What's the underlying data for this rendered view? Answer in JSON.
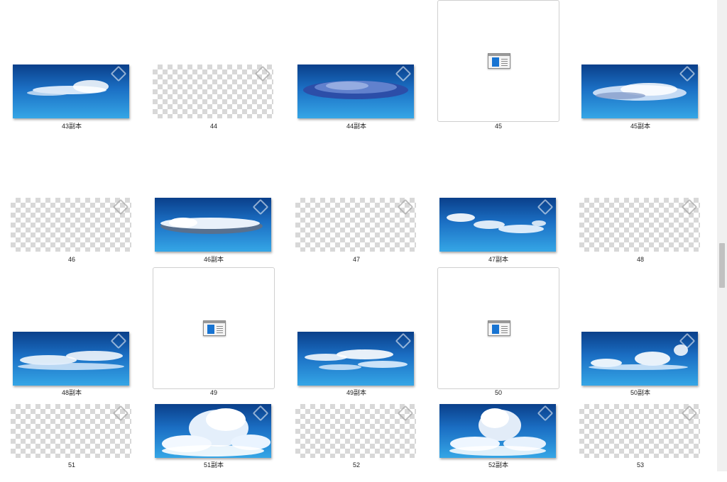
{
  "items": [
    {
      "caption": "43副本",
      "kind": "sky",
      "cloud": "wisp"
    },
    {
      "caption": "44",
      "kind": "transparent"
    },
    {
      "caption": "44副本",
      "kind": "sky",
      "cloud": "dark"
    },
    {
      "caption": "45",
      "kind": "file",
      "selected": true
    },
    {
      "caption": "45副本",
      "kind": "sky",
      "cloud": "long"
    },
    {
      "caption": "46",
      "kind": "transparent"
    },
    {
      "caption": "46副本",
      "kind": "sky",
      "cloud": "roll"
    },
    {
      "caption": "47",
      "kind": "transparent"
    },
    {
      "caption": "47副本",
      "kind": "sky",
      "cloud": "scatter"
    },
    {
      "caption": "48",
      "kind": "transparent"
    },
    {
      "caption": "48副本",
      "kind": "sky",
      "cloud": "band"
    },
    {
      "caption": "49",
      "kind": "file",
      "selected": true
    },
    {
      "caption": "49副本",
      "kind": "sky",
      "cloud": "streaks"
    },
    {
      "caption": "50",
      "kind": "file",
      "selected": true
    },
    {
      "caption": "50副本",
      "kind": "sky",
      "cloud": "puffs"
    },
    {
      "caption": "51",
      "kind": "transparent"
    },
    {
      "caption": "51副本",
      "kind": "sky",
      "cloud": "cumulus"
    },
    {
      "caption": "52",
      "kind": "transparent"
    },
    {
      "caption": "52副本",
      "kind": "sky",
      "cloud": "tower"
    },
    {
      "caption": "53",
      "kind": "transparent"
    }
  ],
  "colors": {
    "sky_top": "#0a3f8a",
    "sky_bottom": "#35a6e6",
    "file_panel": "#1874d2"
  }
}
